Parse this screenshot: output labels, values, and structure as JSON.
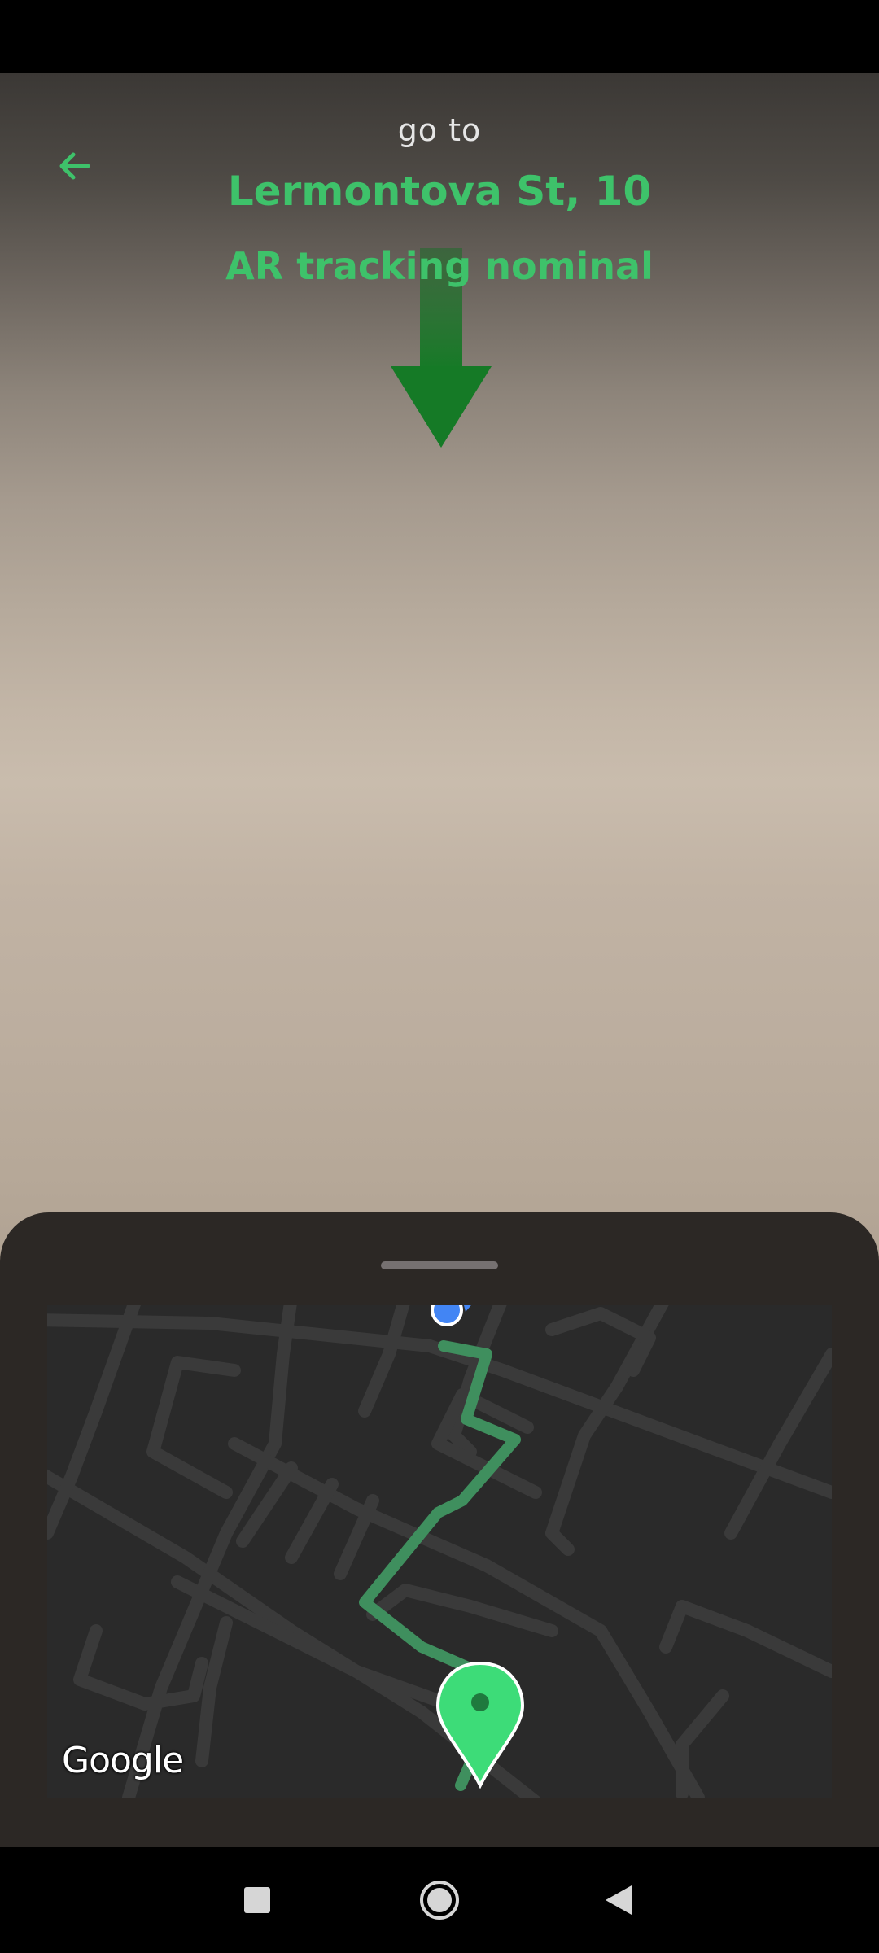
{
  "header": {
    "goto_label": "go to",
    "destination": "Lermontova St, 10",
    "ar_status": "AR tracking nominal"
  },
  "icons": {
    "back": "arrow-left-icon",
    "ar_direction": "arrow-down-icon",
    "destination_pin": "map-pin-icon",
    "current_location": "location-dot-icon",
    "nav_recents": "square-icon",
    "nav_home": "circle-icon",
    "nav_back": "triangle-back-icon"
  },
  "map": {
    "attribution": "Google"
  },
  "colors": {
    "accent": "#3ec26a",
    "route": "#3f8f5e",
    "pin": "#3ddc78",
    "location_dot": "#4285f4",
    "sheet": "#2c2825",
    "map_bg": "#2a2a2a"
  }
}
